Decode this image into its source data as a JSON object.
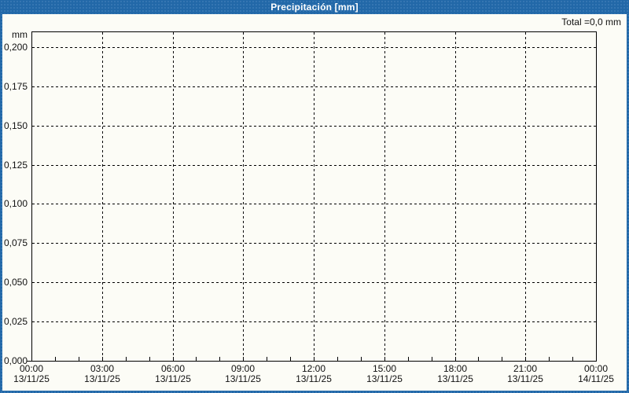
{
  "window": {
    "title": "Precipitación [mm]"
  },
  "summary": {
    "total_label": "Total =0,0 mm"
  },
  "colors": {
    "frame_blue": "#2268a8",
    "frame_dot": "#3b7ab5",
    "plot_bg": "#fcfcf6",
    "grid": "#000000",
    "text": "#111111",
    "title_text": "#ffffff"
  },
  "chart_data": {
    "type": "line",
    "title": "Precipitación [mm]",
    "xlabel": "",
    "ylabel": "mm",
    "ylim": [
      0,
      0.21
    ],
    "xlim_hours": [
      0,
      24
    ],
    "grid": "dashed",
    "legend_position": "none",
    "total_text": "Total =0,0 mm",
    "total_value_mm": 0.0,
    "minor_x_step_hours": 1,
    "y_ticks": [
      {
        "value": 0.2,
        "label": "0,200"
      },
      {
        "value": 0.175,
        "label": "0,175"
      },
      {
        "value": 0.15,
        "label": "0,150"
      },
      {
        "value": 0.125,
        "label": "0,125"
      },
      {
        "value": 0.1,
        "label": "0,100"
      },
      {
        "value": 0.075,
        "label": "0,075"
      },
      {
        "value": 0.05,
        "label": "0,050"
      },
      {
        "value": 0.025,
        "label": "0,025"
      },
      {
        "value": 0.0,
        "label": "0,000"
      }
    ],
    "x_ticks": [
      {
        "hour": 0,
        "time": "00:00",
        "date": "13/11/25"
      },
      {
        "hour": 3,
        "time": "03:00",
        "date": "13/11/25"
      },
      {
        "hour": 6,
        "time": "06:00",
        "date": "13/11/25"
      },
      {
        "hour": 9,
        "time": "09:00",
        "date": "13/11/25"
      },
      {
        "hour": 12,
        "time": "12:00",
        "date": "13/11/25"
      },
      {
        "hour": 15,
        "time": "15:00",
        "date": "13/11/25"
      },
      {
        "hour": 18,
        "time": "18:00",
        "date": "13/11/25"
      },
      {
        "hour": 21,
        "time": "21:00",
        "date": "13/11/25"
      },
      {
        "hour": 24,
        "time": "00:00",
        "date": "14/11/25"
      }
    ],
    "series": [
      {
        "name": "Precipitación",
        "unit": "mm",
        "values": []
      }
    ]
  }
}
